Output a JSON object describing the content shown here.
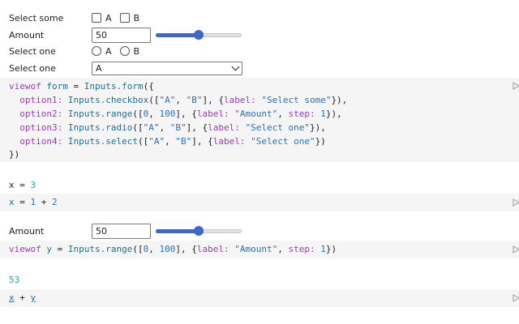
{
  "form": {
    "checkbox": {
      "label": "Select some",
      "options": [
        "A",
        "B"
      ]
    },
    "range": {
      "label": "Amount",
      "value": "50",
      "fraction": 0.5
    },
    "radio": {
      "label": "Select one",
      "options": [
        "A",
        "B"
      ]
    },
    "select": {
      "label": "Select one",
      "value": "A"
    }
  },
  "cell1": {
    "l1": {
      "viewof": "viewof",
      "form": "form",
      "eq": "=",
      "inputs": "Inputs",
      "form_fn": ".form",
      "open": "({"
    },
    "l2": {
      "key": "option1:",
      "inputs": "Inputs",
      "fn": ".checkbox",
      "open": "([",
      "a": "\"A\"",
      "comma1": ", ",
      "b": "\"B\"",
      "close": "], {",
      "labelk": "label:",
      "labelv": "\"Select some\"",
      "end": "}),"
    },
    "l3": {
      "key": "option2:",
      "inputs": "Inputs",
      "fn": ".range",
      "open": "([",
      "n0": "0",
      "comma1": ", ",
      "n100": "100",
      "close": "], {",
      "labelk": "label:",
      "labelv": "\"Amount\"",
      "comma2": ", ",
      "stepk": "step:",
      "stepv": "1",
      "end": "}),"
    },
    "l4": {
      "key": "option3:",
      "inputs": "Inputs",
      "fn": ".radio",
      "open": "([",
      "a": "\"A\"",
      "comma1": ", ",
      "b": "\"B\"",
      "close": "], {",
      "labelk": "label:",
      "labelv": "\"Select one\"",
      "end": "}),"
    },
    "l5": {
      "key": "option4:",
      "inputs": "Inputs",
      "fn": ".select",
      "open": "([",
      "a": "\"A\"",
      "comma1": ", ",
      "b": "\"B\"",
      "close": "], {",
      "labelk": "label:",
      "labelv": "\"Select one\"",
      "end": "})"
    },
    "l6": "})"
  },
  "output_x": {
    "name": "x",
    "eq": " = ",
    "value": "3"
  },
  "cell2": {
    "x": "x",
    "eq": " = ",
    "one": "1",
    "plus": " + ",
    "two": "2"
  },
  "range2": {
    "label": "Amount",
    "value": "50",
    "fraction": 0.5
  },
  "cell3": {
    "viewof": "viewof",
    "y": "y",
    "eq": "=",
    "inputs": "Inputs",
    "fn": ".range",
    "open": "([",
    "n0": "0",
    "comma1": ", ",
    "n100": "100",
    "close": "], {",
    "labelk": "label:",
    "labelv": "\"Amount\"",
    "comma2": ", ",
    "stepk": "step:",
    "stepv": "1",
    "end": "})"
  },
  "output_sum": {
    "value": "53"
  },
  "cell4": {
    "x": "x",
    "plus": " + ",
    "y": "y"
  }
}
